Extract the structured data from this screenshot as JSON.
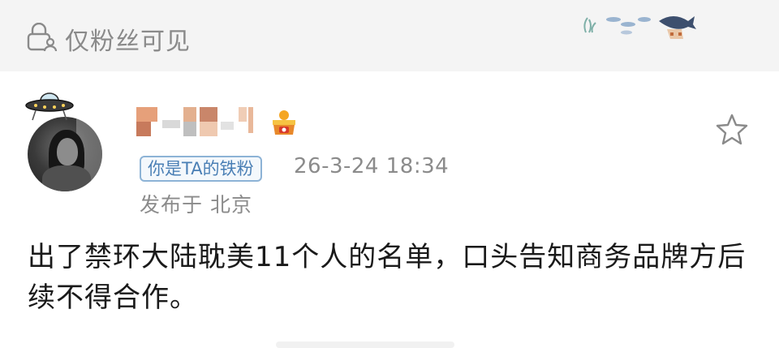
{
  "header": {
    "visibility_label": "仅粉丝可见",
    "visibility_icon": "lock-person-icon",
    "decoration_icon": "ocean-fish-decoration-icon"
  },
  "post": {
    "author": {
      "avatar_icon": "avatar-photo",
      "avatar_ornament_icon": "ufo-icon",
      "username_mosaic": "pixelated-username",
      "member_badge_icon": "crown-badge-icon"
    },
    "fan_tag": "你是TA的铁粉",
    "timestamp": "26-3-24 18:34",
    "location": "发布于 北京",
    "favorite_icon": "star-icon",
    "content": "出了禁环大陆耽美11个人的名单，口头告知商务品牌方后续不得合作。"
  },
  "colors": {
    "header_bg": "#f4f4f4",
    "tag_border": "#8db3d6",
    "tag_text": "#4a7fb5",
    "meta_text": "#8b8b8b",
    "body_text": "#1a1a1a"
  }
}
